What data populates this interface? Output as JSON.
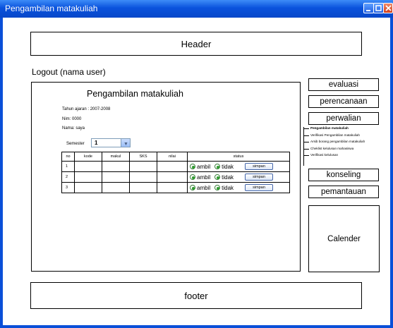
{
  "window": {
    "title": "Pengambilan matakuliah",
    "accent": "#0a52dd"
  },
  "header": {
    "label": "Header"
  },
  "footer": {
    "label": "footer"
  },
  "user": {
    "logout_text": "Logout (nama user)"
  },
  "main": {
    "title": "Pengambilan matakuliah",
    "tahun_ajaran": "Tahun ajaran : 2007-2008",
    "nim": "Nim: 0000",
    "nama": "Nama: saya",
    "semester_label": "Semester",
    "semester_value": "1",
    "table": {
      "headers": [
        "no",
        "kode",
        "makul",
        "SKS",
        "nilai",
        "status"
      ],
      "rows": [
        {
          "no": "1",
          "ambil": "ambil",
          "tidak": "tidak",
          "button": "simpan"
        },
        {
          "no": "2",
          "ambil": "ambil",
          "tidak": "tidak",
          "button": "simpan"
        },
        {
          "no": "3",
          "ambil": "ambil",
          "tidak": "tidak",
          "button": "simpan"
        }
      ]
    }
  },
  "sidebar": {
    "evaluasi": "evaluasi",
    "perencanaan": "perencanaan",
    "perwalian": "perwalian",
    "submenu": [
      "Pengambilan matakuliah",
      "Verifikasi Pengambilan matakuliah",
      "Arsib borang pengambilan matakuliah",
      "Cheklist kelulusan mahasiswa",
      "Verifikasi kelulusan"
    ],
    "konseling": "konseling",
    "pemantauan": "pemantauan",
    "calendar": "Calender"
  }
}
